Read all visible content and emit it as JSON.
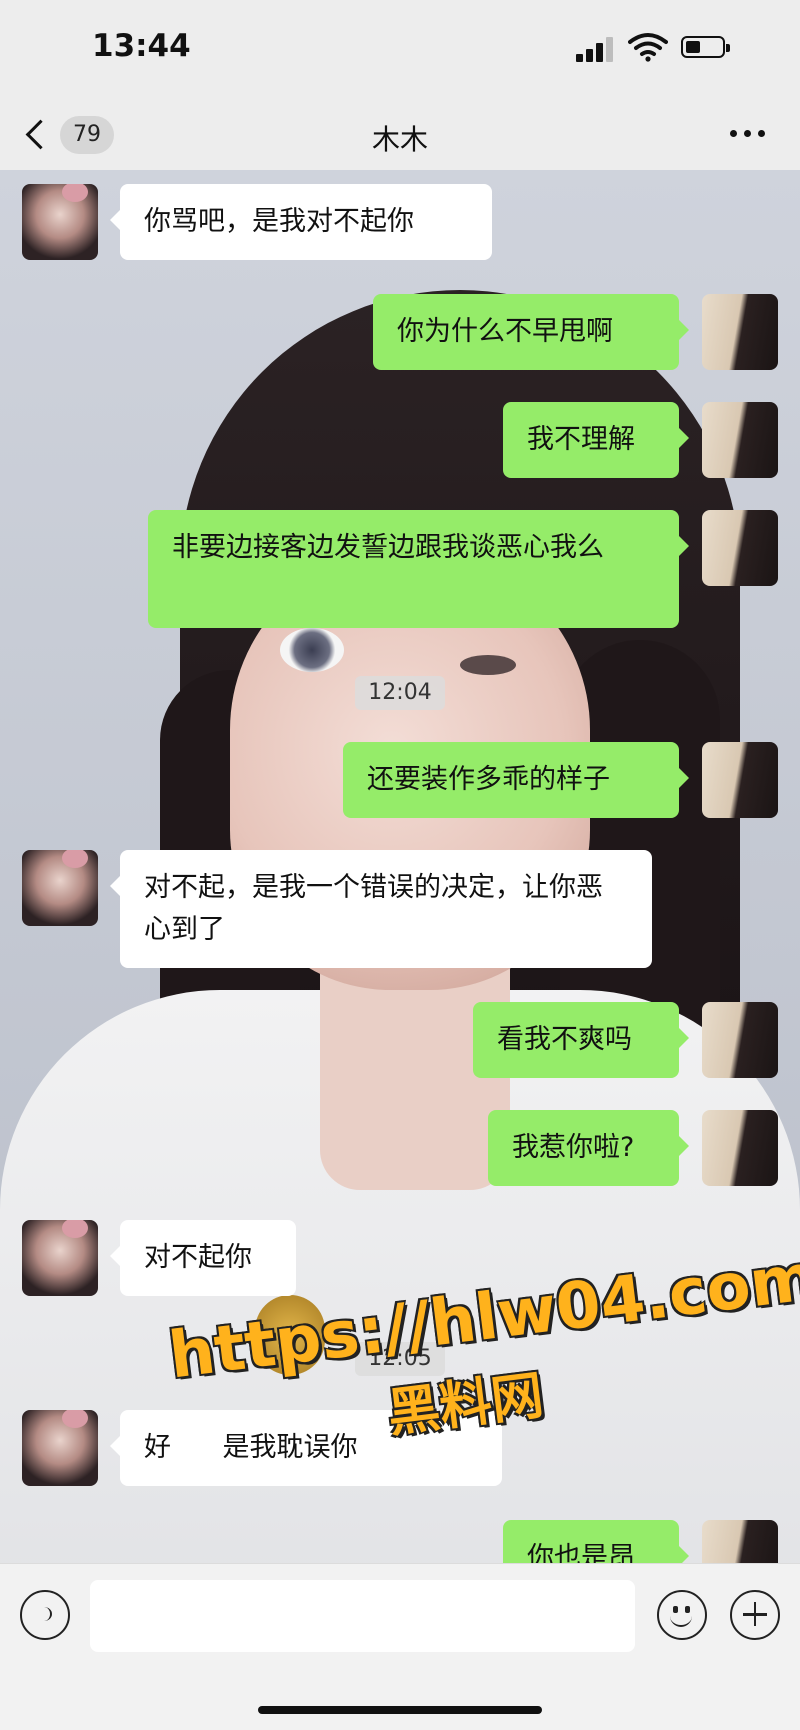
{
  "status_bar": {
    "time": "13:44"
  },
  "header": {
    "back_count": "79",
    "title": "木木"
  },
  "messages": [
    {
      "side": "left",
      "text": "你骂吧，是我对不起你"
    },
    {
      "side": "right",
      "text": "你为什么不早甩啊"
    },
    {
      "side": "right",
      "text": "我不理解"
    },
    {
      "side": "right",
      "text": "非要边接客边发誓边跟我谈恶心我么"
    },
    {
      "side": "right",
      "text": "还要装作多乖的样子"
    },
    {
      "side": "left",
      "text": "对不起，是我一个错误的决定，让你恶心到了"
    },
    {
      "side": "right",
      "text": "看我不爽吗"
    },
    {
      "side": "right",
      "text": "我惹你啦?"
    },
    {
      "side": "left",
      "text": "对不起你"
    },
    {
      "side": "left",
      "text": "好      是我耽误你"
    },
    {
      "side": "right",
      "text": "你也是昂"
    }
  ],
  "timestamps": [
    "12:04",
    "12:05"
  ],
  "watermark": {
    "line1": "https://hlw04.com",
    "line2": "黑料网"
  },
  "input": {
    "value": ""
  },
  "icons": {
    "back": "chevron-left-icon",
    "more": "more-dots-icon",
    "voice": "voice-icon",
    "emoji": "emoji-icon",
    "add": "plus-icon"
  }
}
